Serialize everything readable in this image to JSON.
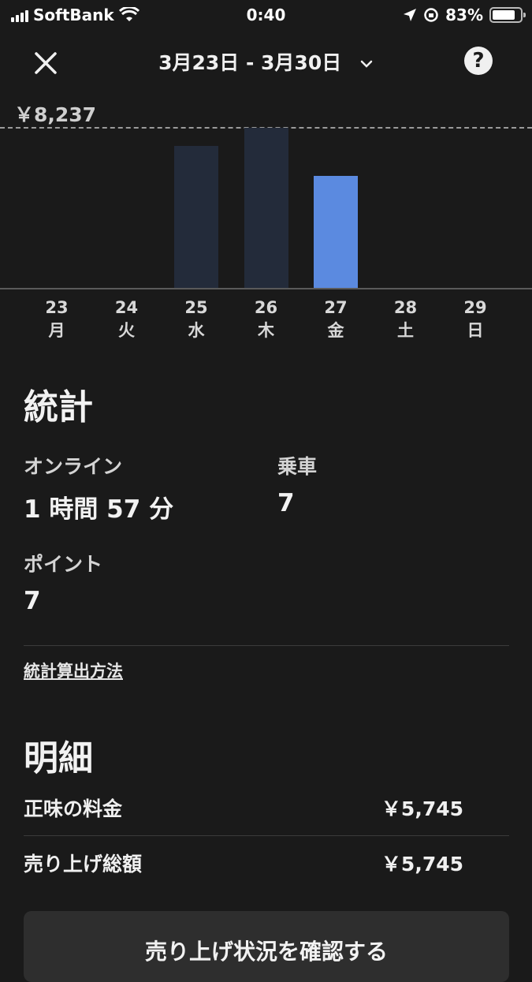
{
  "status_bar": {
    "carrier": "SoftBank",
    "time": "0:40",
    "battery": "83%",
    "battery_level": 0.83
  },
  "nav": {
    "date_range": "3月23日 - 3月30日",
    "help_glyph": "?"
  },
  "chart_data": {
    "type": "bar",
    "max_label": "￥8,237",
    "ylim": [
      0,
      8237
    ],
    "categories": [
      "23",
      "24",
      "25",
      "26",
      "27",
      "28",
      "29"
    ],
    "weekdays": [
      "月",
      "火",
      "水",
      "木",
      "金",
      "土",
      "日"
    ],
    "values": [
      0,
      0,
      7300,
      8237,
      5745,
      0,
      0
    ],
    "selected_index": 4,
    "colors": {
      "bar": "#232b3a",
      "selected": "#5b8ae0"
    }
  },
  "stats": {
    "title": "統計",
    "online_label": "オンライン",
    "online_value": "1 時間 57 分",
    "rides_label": "乗車",
    "rides_value": "7",
    "points_label": "ポイント",
    "points_value": "7",
    "method_link": "統計算出方法"
  },
  "details": {
    "title": "明細",
    "rows": [
      {
        "label": "正味の料金",
        "amount": "￥5,745"
      },
      {
        "label": "売り上げ総額",
        "amount": "￥5,745"
      }
    ]
  },
  "cta_label": "売り上げ状況を確認する"
}
